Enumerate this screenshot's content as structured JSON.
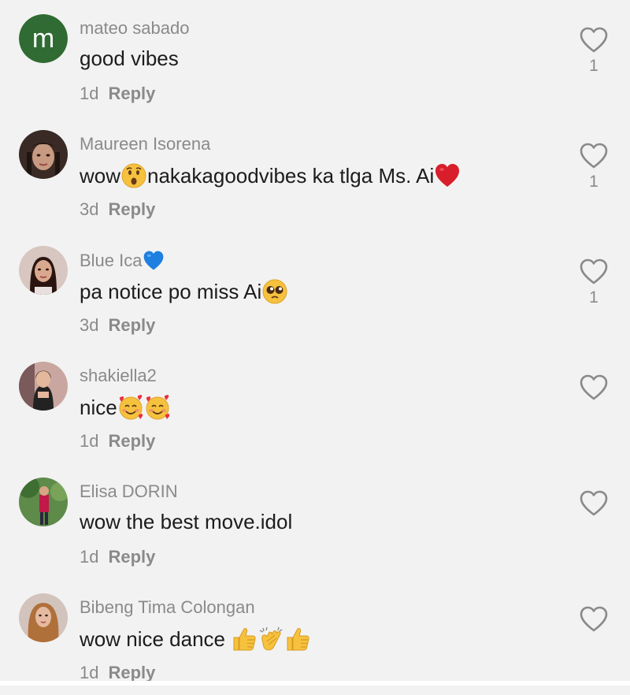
{
  "colors": {
    "background": "#f2f2f2",
    "username": "#8a8a8a",
    "text": "#1c1c1c",
    "meta": "#8a8a8a",
    "avatar_m": "#2f6b32"
  },
  "comments": [
    {
      "username": "mateo sabado",
      "avatar_letter": "m",
      "text": "good vibes",
      "date": "1d",
      "reply": "Reply",
      "likes": "1"
    },
    {
      "username": "Maureen Isorena",
      "text_1": "wow",
      "text_2": " nakakagoodvibes ka tlga Ms. Ai",
      "date": "3d",
      "reply": "Reply",
      "likes": "1",
      "emojis": [
        "astonished-face",
        "red-heart"
      ]
    },
    {
      "username": "Blue Ica",
      "text": "pa notice po miss Ai",
      "date": "3d",
      "reply": "Reply",
      "likes": "1",
      "emojis": [
        "blue-heart",
        "pleading-face"
      ]
    },
    {
      "username": "shakiella2",
      "text": "nice",
      "date": "1d",
      "reply": "Reply",
      "emojis": [
        "smiling-face-with-hearts",
        "smiling-face-with-hearts"
      ]
    },
    {
      "username": "Elisa DORIN",
      "text": "wow the best move.idol",
      "date": "1d",
      "reply": "Reply"
    },
    {
      "username": "Bibeng Tima Colongan",
      "text": "wow nice dance ",
      "date": "1d",
      "reply": "Reply",
      "emojis": [
        "thumbs-up",
        "clapping-hands",
        "thumbs-up"
      ]
    }
  ]
}
